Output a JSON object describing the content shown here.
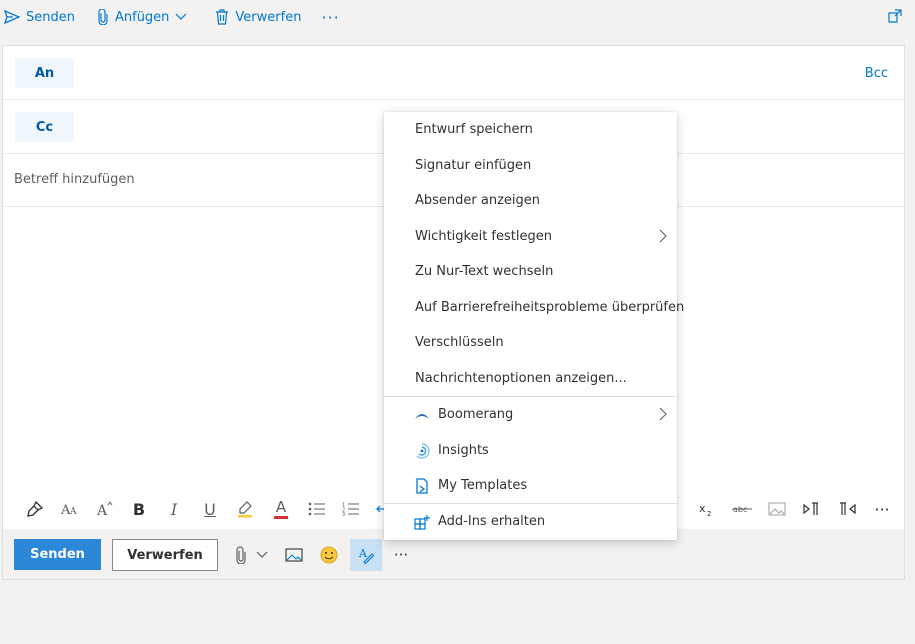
{
  "topbar": {
    "send_label": "Senden",
    "attach_label": "Anfügen",
    "discard_label": "Verwerfen",
    "more_label": "···"
  },
  "compose": {
    "to_label": "An",
    "cc_label": "Cc",
    "bcc_label": "Bcc",
    "subject_placeholder": "Betreff hinzufügen"
  },
  "actions": {
    "send_label": "Senden",
    "discard_label": "Verwerfen",
    "more_label": "···"
  },
  "formatting": {
    "bold": "B",
    "italic": "I",
    "underline": "U",
    "font_color": "A",
    "more_label": "···"
  },
  "menu": {
    "items": [
      {
        "label": "Entwurf speichern"
      },
      {
        "label": "Signatur einfügen"
      },
      {
        "label": "Absender anzeigen"
      },
      {
        "label": "Wichtigkeit festlegen"
      },
      {
        "label": "Zu Nur-Text wechseln"
      },
      {
        "label": "Auf Barrierefreiheitsprobleme überprüfen"
      },
      {
        "label": "Verschlüsseln"
      },
      {
        "label": "Nachrichtenoptionen anzeigen..."
      }
    ],
    "addins": [
      {
        "label": "Boomerang",
        "icon": "boomerang-icon"
      },
      {
        "label": "Insights",
        "icon": "insights-icon"
      },
      {
        "label": "My Templates",
        "icon": "templates-icon"
      }
    ],
    "get_addins_label": "Add-Ins erhalten"
  },
  "colors": {
    "accent": "#0078d4",
    "send_button": "#2b88d8",
    "chip_bg": "#eff6fc",
    "active_tool_bg": "#c7e0f4"
  }
}
